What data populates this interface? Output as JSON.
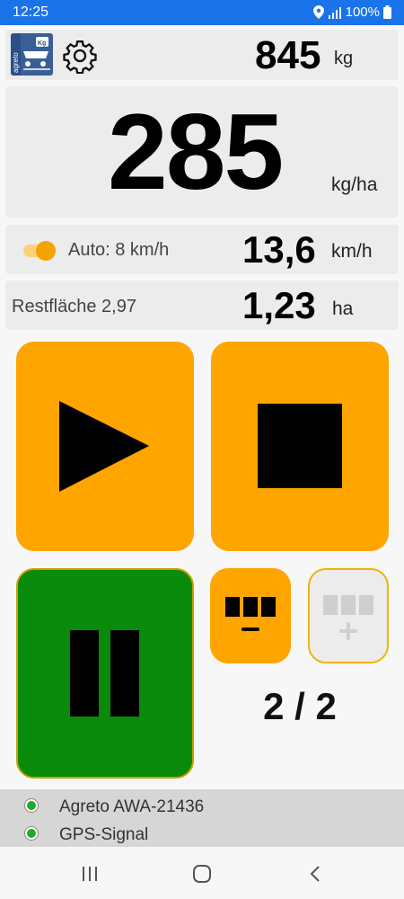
{
  "status_bar": {
    "time": "12:25",
    "battery": "100%"
  },
  "header": {
    "logo_text": "agreto",
    "logo_badge": "Kg",
    "weight_value": "845",
    "weight_unit": "kg"
  },
  "rate": {
    "value": "285",
    "unit": "kg/ha"
  },
  "speed": {
    "mode_label": "Auto: 8 km/h",
    "auto_enabled": true,
    "value": "13,6",
    "unit": "km/h"
  },
  "area": {
    "remaining_label": "Restfläche 2,97",
    "value": "1,23",
    "unit": "ha"
  },
  "controls": {
    "play": "play-icon",
    "stop": "stop-icon",
    "pause": "pause-icon"
  },
  "sections": {
    "counter": "2 / 2"
  },
  "footer": {
    "items": [
      {
        "label": "Agreto AWA-21436",
        "status_color": "#22aa22"
      },
      {
        "label": "GPS-Signal",
        "status_color": "#22aa22"
      }
    ]
  },
  "colors": {
    "accent": "#ffa500",
    "pause": "#0a8a0a",
    "statusbar": "#1a73e8"
  }
}
